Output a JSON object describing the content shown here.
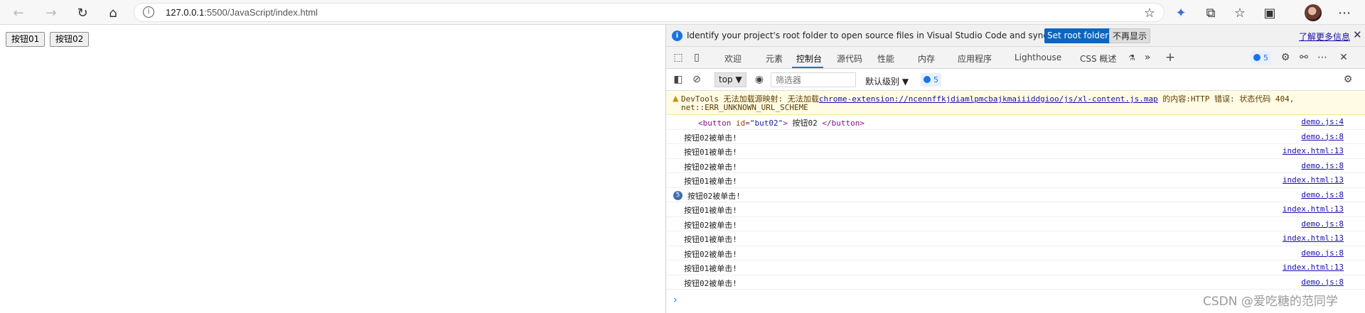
{
  "browser": {
    "address_host": "127.0.0.1",
    "address_path": ":5500/JavaScript/index.html",
    "icons": {
      "back": "back-arrow-icon",
      "forward": "forward-arrow-icon",
      "refresh": "refresh-icon",
      "home": "home-icon",
      "info": "site-info-icon",
      "favorite": "favorite-star-icon",
      "extension_active": "extension-icon",
      "extensions": "puzzle-icon",
      "favorites": "favorites-list-icon",
      "collections": "collections-icon",
      "profile": "avatar",
      "more": "more-icon"
    }
  },
  "page": {
    "buttons": [
      "按钮01",
      "按钮02"
    ]
  },
  "devtools": {
    "infobar": {
      "text": "Identify your project's root folder to open source files in Visual Studio Code and sync changes.",
      "primary_button": "Set root folder",
      "secondary_button": "不再显示",
      "learn_more": "了解更多信息"
    },
    "tabs": [
      "欢迎",
      "元素",
      "控制台",
      "源代码",
      "性能",
      "内存",
      "应用程序",
      "Lighthouse",
      "CSS 概述"
    ],
    "active_tab": "控制台",
    "issues_count": "5",
    "filter": {
      "context": "top",
      "placeholder": "筛选器",
      "levels": "默认级别",
      "issues_count": "5"
    },
    "console": {
      "warning": {
        "prefix": "DevTools 无法加载源映射: 无法加载",
        "link": "chrome-extension://ncennffkjdiamlpmcbajkmaiiiddgioo/js/xl-content.js.map",
        "suffix": " 的内容:HTTP 错误: 状态代码 404,",
        "line2": "net::ERR_UNKNOWN_URL_SCHEME"
      },
      "element_log": {
        "open_tag": "<button",
        "attr_name": "id",
        "attr_value": "\"but02\"",
        "close_open": ">",
        "text": " 按钮02 ",
        "close_tag": "</button>",
        "source": "demo.js:4"
      },
      "rows": [
        {
          "text": "按钮02被单击!",
          "source": "demo.js:8"
        },
        {
          "text": "按钮01被单击!",
          "source": "index.html:13"
        },
        {
          "text": "按钮02被单击!",
          "source": "demo.js:8"
        },
        {
          "text": "按钮01被单击!",
          "source": "index.html:13"
        },
        {
          "count": "5",
          "text": "按钮02被单击!",
          "source": "demo.js:8"
        },
        {
          "text": "按钮01被单击!",
          "source": "index.html:13"
        },
        {
          "text": "按钮02被单击!",
          "source": "demo.js:8"
        },
        {
          "text": "按钮01被单击!",
          "source": "index.html:13"
        },
        {
          "text": "按钮02被单击!",
          "source": "demo.js:8"
        },
        {
          "text": "按钮01被单击!",
          "source": "index.html:13"
        },
        {
          "text": "按钮02被单击!",
          "source": "demo.js:8"
        }
      ],
      "prompt": "›"
    }
  },
  "watermark": "CSDN @爱吃糖的范同学"
}
